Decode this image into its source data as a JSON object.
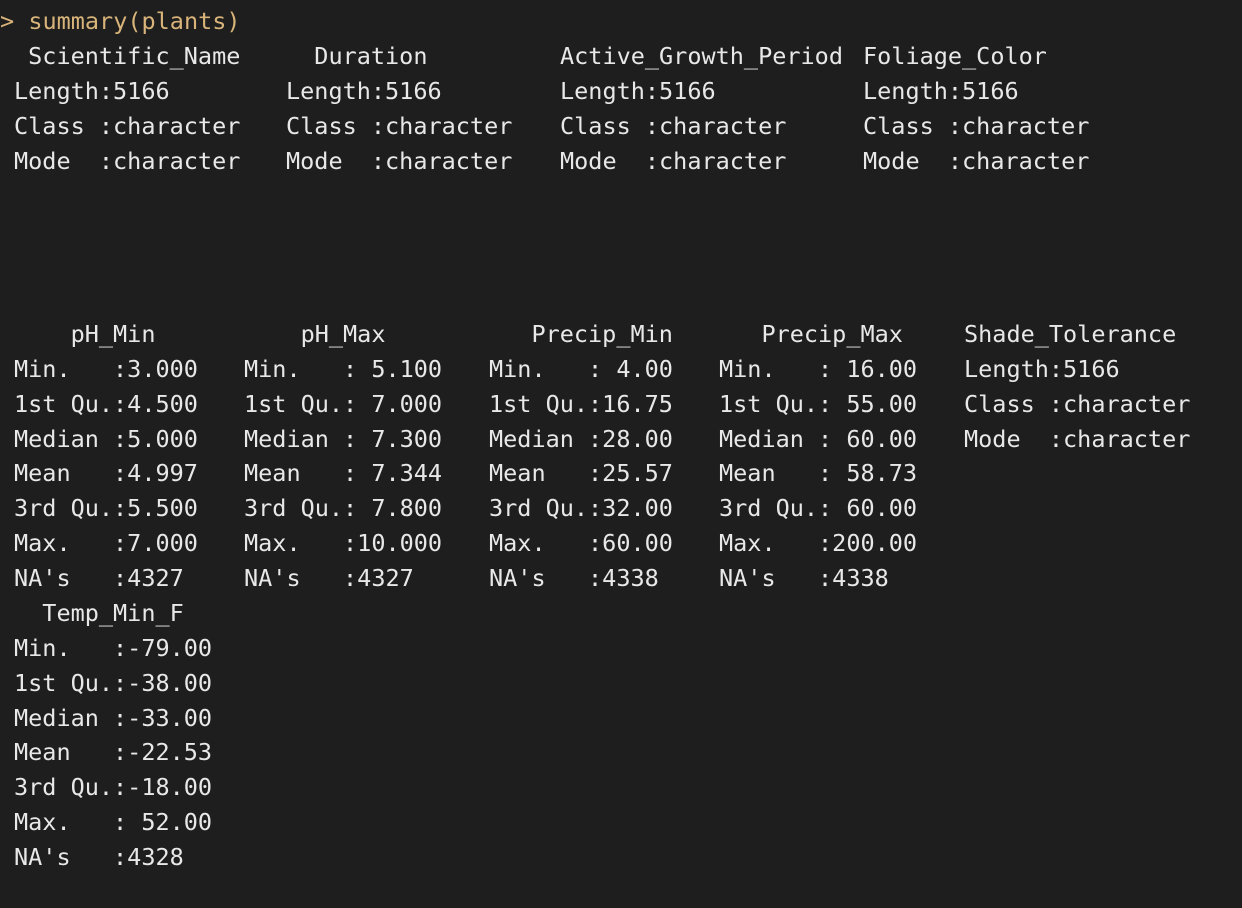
{
  "console": {
    "prompt_symbol": ">",
    "command": "summary(plants)",
    "block1": {
      "columns": [
        {
          "header": " Scientific_Name  ",
          "lines": [
            "Length:5166",
            "Class :character",
            "Mode  :character"
          ]
        },
        {
          "header": "  Duration  ",
          "lines": [
            "Length:5166",
            "Class :character",
            "Mode  :character"
          ]
        },
        {
          "header": "Active_Growth_Period",
          "lines": [
            "Length:5166",
            "Class :character",
            "Mode  :character"
          ]
        },
        {
          "header": "Foliage_Color",
          "lines": [
            "Length:5166",
            "Class :character",
            "Mode  :character"
          ]
        }
      ]
    },
    "block2": {
      "columns": [
        {
          "header": "    pH_Min",
          "lines": [
            "Min.   :3.000",
            "1st Qu.:4.500",
            "Median :5.000",
            "Mean   :4.997",
            "3rd Qu.:5.500",
            "Max.   :7.000",
            "NA's   :4327"
          ]
        },
        {
          "header": "    pH_Max",
          "lines": [
            "Min.   : 5.100",
            "1st Qu.: 7.000",
            "Median : 7.300",
            "Mean   : 7.344",
            "3rd Qu.: 7.800",
            "Max.   :10.000",
            "NA's   :4327"
          ]
        },
        {
          "header": "   Precip_Min",
          "lines": [
            "Min.   : 4.00",
            "1st Qu.:16.75",
            "Median :28.00",
            "Mean   :25.57",
            "3rd Qu.:32.00",
            "Max.   :60.00",
            "NA's   :4338"
          ]
        },
        {
          "header": "   Precip_Max",
          "lines": [
            "Min.   : 16.00",
            "1st Qu.: 55.00",
            "Median : 60.00",
            "Mean   : 58.73",
            "3rd Qu.: 60.00",
            "Max.   :200.00",
            "NA's   :4338"
          ]
        },
        {
          "header": "Shade_Tolerance",
          "lines": [
            "Length:5166",
            "Class :character",
            "Mode  :character"
          ]
        }
      ]
    },
    "block3": {
      "columns": [
        {
          "header": "  Temp_Min_F",
          "lines": [
            "Min.   :-79.00",
            "1st Qu.:-38.00",
            "Median :-33.00",
            "Mean   :-22.53",
            "3rd Qu.:-18.00",
            "Max.   : 52.00",
            "NA's   :4328"
          ]
        }
      ]
    }
  }
}
